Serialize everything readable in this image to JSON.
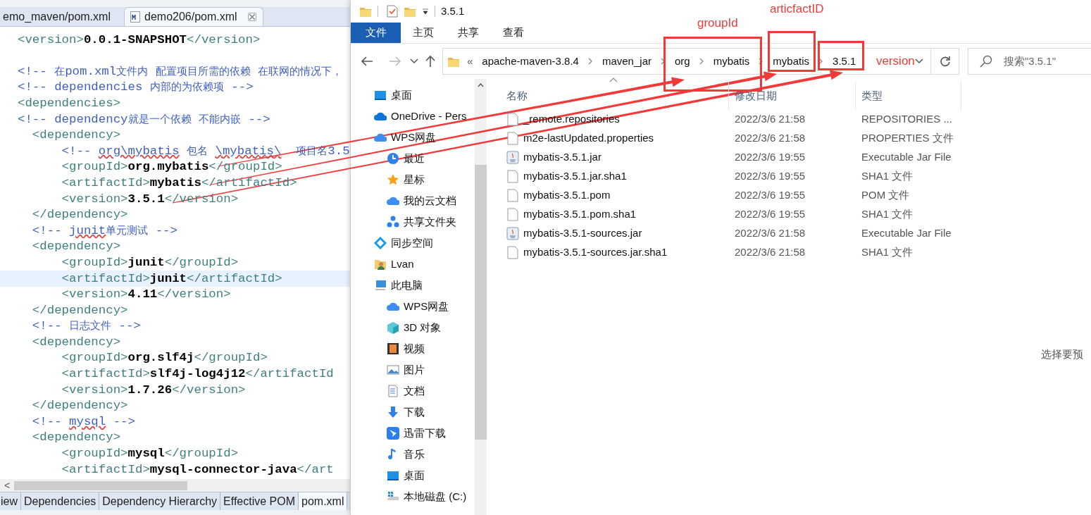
{
  "editor": {
    "tabs": [
      {
        "label": "emo_maven/pom.xml",
        "selected": false
      },
      {
        "label": "demo206/pom.xml",
        "selected": true
      }
    ],
    "lines": [
      {
        "kind": "code",
        "current": false,
        "segments": [
          {
            "kind": "tag",
            "text": "<version>"
          },
          {
            "kind": "value",
            "text": "0.0.1-SNAPSHOT"
          },
          {
            "kind": "tag",
            "text": "</version>"
          }
        ]
      },
      {
        "kind": "blank",
        "current": false
      },
      {
        "kind": "code",
        "current": false,
        "segments": [
          {
            "kind": "comment",
            "text": "<!-- 在pom.xml文件内 配置项目所需的依赖 在联网的情况下，"
          }
        ]
      },
      {
        "kind": "code",
        "current": false,
        "segments": [
          {
            "kind": "comment",
            "text": "<!-- dependencies 内部的为依赖项 -->"
          }
        ]
      },
      {
        "kind": "code",
        "current": false,
        "segments": [
          {
            "kind": "tag",
            "text": "<dependencies>"
          }
        ]
      },
      {
        "kind": "code",
        "current": false,
        "segments": [
          {
            "kind": "comment",
            "text": "<!-- dependency就是一个依赖 不能内嵌 -->"
          }
        ]
      },
      {
        "kind": "code",
        "current": false,
        "segments": [
          {
            "kind": "tag",
            "text": "  <dependency>"
          }
        ]
      },
      {
        "kind": "code",
        "current": false,
        "segments": [
          {
            "kind": "comment",
            "text": "      <!-- "
          },
          {
            "kind": "misspelled",
            "text": "org\\mybatis"
          },
          {
            "kind": "comment",
            "text": " 包名 "
          },
          {
            "kind": "misspelled",
            "text": "\\mybatis\\"
          },
          {
            "kind": "comment",
            "text": "  项目名3.5"
          }
        ]
      },
      {
        "kind": "code",
        "current": false,
        "segments": [
          {
            "kind": "tag",
            "text": "      <groupId>"
          },
          {
            "kind": "value",
            "text": "org.mybatis"
          },
          {
            "kind": "tag",
            "text": "</groupId>"
          }
        ]
      },
      {
        "kind": "code",
        "current": false,
        "segments": [
          {
            "kind": "tag",
            "text": "      <artifactId>"
          },
          {
            "kind": "value",
            "text": "mybatis"
          },
          {
            "kind": "tag",
            "text": "</artifactId>"
          }
        ]
      },
      {
        "kind": "code",
        "current": false,
        "segments": [
          {
            "kind": "tag",
            "text": "      <version>"
          },
          {
            "kind": "value",
            "text": "3.5.1"
          },
          {
            "kind": "tag",
            "text": "</version>"
          }
        ]
      },
      {
        "kind": "code",
        "current": false,
        "segments": [
          {
            "kind": "tag",
            "text": "  </dependency>"
          }
        ]
      },
      {
        "kind": "code",
        "current": false,
        "segments": [
          {
            "kind": "comment",
            "text": "  <!-- "
          },
          {
            "kind": "misspelled",
            "text": "junit"
          },
          {
            "kind": "comment",
            "text": "单元测试 -->"
          }
        ]
      },
      {
        "kind": "code",
        "current": false,
        "segments": [
          {
            "kind": "tag",
            "text": "  <dependency>"
          }
        ]
      },
      {
        "kind": "code",
        "current": false,
        "segments": [
          {
            "kind": "tag",
            "text": "      <groupId>"
          },
          {
            "kind": "value",
            "text": "junit"
          },
          {
            "kind": "tag",
            "text": "</groupId>"
          }
        ]
      },
      {
        "kind": "code",
        "current": true,
        "segments": [
          {
            "kind": "tag",
            "text": "      <artifactId>"
          },
          {
            "kind": "value",
            "text": "junit"
          },
          {
            "kind": "tag",
            "text": "</artifactId>"
          }
        ]
      },
      {
        "kind": "code",
        "current": false,
        "segments": [
          {
            "kind": "tag",
            "text": "      <version>"
          },
          {
            "kind": "value",
            "text": "4.11"
          },
          {
            "kind": "tag",
            "text": "</version>"
          }
        ]
      },
      {
        "kind": "code",
        "current": false,
        "segments": [
          {
            "kind": "tag",
            "text": "  </dependency>"
          }
        ]
      },
      {
        "kind": "code",
        "current": false,
        "segments": [
          {
            "kind": "comment",
            "text": "  <!-- 日志文件 -->"
          }
        ]
      },
      {
        "kind": "code",
        "current": false,
        "segments": [
          {
            "kind": "tag",
            "text": "  <dependency>"
          }
        ]
      },
      {
        "kind": "code",
        "current": false,
        "segments": [
          {
            "kind": "tag",
            "text": "      <groupId>"
          },
          {
            "kind": "value",
            "text": "org.slf4j"
          },
          {
            "kind": "tag",
            "text": "</groupId>"
          }
        ]
      },
      {
        "kind": "code",
        "current": false,
        "segments": [
          {
            "kind": "tag",
            "text": "      <artifactId>"
          },
          {
            "kind": "value",
            "text": "slf4j-log4j12"
          },
          {
            "kind": "tag",
            "text": "</artifactId"
          }
        ]
      },
      {
        "kind": "code",
        "current": false,
        "segments": [
          {
            "kind": "tag",
            "text": "      <version>"
          },
          {
            "kind": "value",
            "text": "1.7.26"
          },
          {
            "kind": "tag",
            "text": "</version>"
          }
        ]
      },
      {
        "kind": "code",
        "current": false,
        "segments": [
          {
            "kind": "tag",
            "text": "  </dependency>"
          }
        ]
      },
      {
        "kind": "code",
        "current": false,
        "segments": [
          {
            "kind": "comment",
            "text": "  <!-- "
          },
          {
            "kind": "misspelled",
            "text": "mysql"
          },
          {
            "kind": "comment",
            "text": " -->"
          }
        ]
      },
      {
        "kind": "code",
        "current": false,
        "segments": [
          {
            "kind": "tag",
            "text": "  <dependency>"
          }
        ]
      },
      {
        "kind": "code",
        "current": false,
        "segments": [
          {
            "kind": "tag",
            "text": "      <groupId>"
          },
          {
            "kind": "value",
            "text": "mysql"
          },
          {
            "kind": "tag",
            "text": "</groupId>"
          }
        ]
      },
      {
        "kind": "code",
        "current": false,
        "segments": [
          {
            "kind": "tag",
            "text": "      <artifactId>"
          },
          {
            "kind": "value",
            "text": "mysql-connector-java"
          },
          {
            "kind": "tag",
            "text": "</art"
          }
        ]
      }
    ],
    "scroll_arrow": "<",
    "bottom_tabs": [
      {
        "label": "iew",
        "selected": false
      },
      {
        "label": "Dependencies",
        "selected": false
      },
      {
        "label": "Dependency Hierarchy",
        "selected": false
      },
      {
        "label": "Effective POM",
        "selected": false
      },
      {
        "label": "pom.xml",
        "selected": true
      }
    ]
  },
  "explorer": {
    "title": "3.5.1",
    "ribbon_tabs": [
      {
        "label": "文件",
        "selected": true
      },
      {
        "label": "主页",
        "selected": false
      },
      {
        "label": "共享",
        "selected": false
      },
      {
        "label": "查看",
        "selected": false
      }
    ],
    "address": {
      "overflow": "«",
      "crumbs": [
        "apache-maven-3.8.4",
        "maven_jar",
        "org",
        "mybatis",
        "mybatis",
        "3.5.1"
      ]
    },
    "search": {
      "placeholder": "搜索\"3.5.1\""
    },
    "nav": [
      {
        "label": "桌面"
      },
      {
        "label": "OneDrive - Pers"
      },
      {
        "label": "WPS网盘",
        "children": [
          {
            "label": "最近"
          },
          {
            "label": "星标"
          },
          {
            "label": "我的云文档"
          },
          {
            "label": "共享文件夹"
          }
        ]
      },
      {
        "label": "同步空间"
      },
      {
        "label": "Lvan"
      },
      {
        "label": "此电脑",
        "children": [
          {
            "label": "WPS网盘"
          },
          {
            "label": "3D 对象"
          },
          {
            "label": "视频"
          },
          {
            "label": "图片"
          },
          {
            "label": "文档"
          },
          {
            "label": "下载"
          },
          {
            "label": "迅雷下载"
          },
          {
            "label": "音乐"
          },
          {
            "label": "桌面"
          },
          {
            "label": "本地磁盘 (C:)"
          }
        ]
      }
    ],
    "columns": [
      "名称",
      "修改日期",
      "类型"
    ],
    "files": [
      {
        "kind": "file",
        "name": "_remote.repositories",
        "date": "2022/3/6 21:58",
        "type": "REPOSITORIES ..."
      },
      {
        "kind": "file",
        "name": "m2e-lastUpdated.properties",
        "date": "2022/3/6 21:58",
        "type": "PROPERTIES 文件"
      },
      {
        "kind": "jar",
        "name": "mybatis-3.5.1.jar",
        "date": "2022/3/6 19:55",
        "type": "Executable Jar File"
      },
      {
        "kind": "file",
        "name": "mybatis-3.5.1.jar.sha1",
        "date": "2022/3/6 19:55",
        "type": "SHA1 文件"
      },
      {
        "kind": "file",
        "name": "mybatis-3.5.1.pom",
        "date": "2022/3/6 19:55",
        "type": "POM 文件"
      },
      {
        "kind": "file",
        "name": "mybatis-3.5.1.pom.sha1",
        "date": "2022/3/6 19:55",
        "type": "SHA1 文件"
      },
      {
        "kind": "jar",
        "name": "mybatis-3.5.1-sources.jar",
        "date": "2022/3/6 21:58",
        "type": "Executable Jar File"
      },
      {
        "kind": "file",
        "name": "mybatis-3.5.1-sources.jar.sha1",
        "date": "2022/3/6 21:58",
        "type": "SHA1 文件"
      }
    ],
    "preview_hint": "选择要预"
  },
  "annotations": {
    "labels": [
      "groupId",
      "articfactID",
      "version"
    ]
  }
}
